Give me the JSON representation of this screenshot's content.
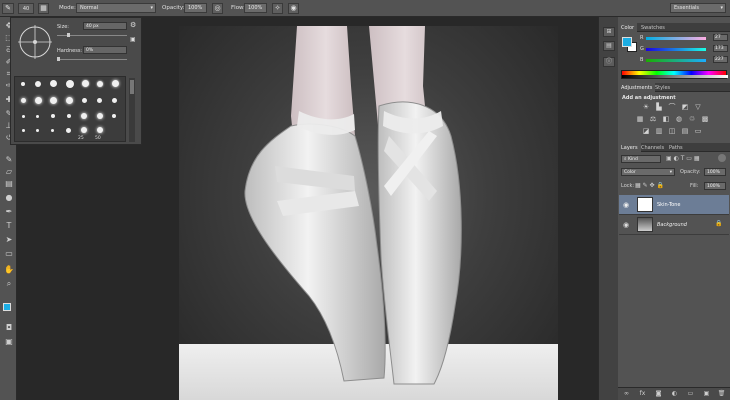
{
  "options_bar": {
    "brush_size": "40",
    "mode_label": "Mode:",
    "mode_value": "Normal",
    "opacity_label": "Opacity:",
    "opacity_value": "100%",
    "flow_label": "Flow:",
    "flow_value": "100%",
    "workspace": "Essentials"
  },
  "brush_panel": {
    "size_label": "Size:",
    "size_value": "40 px",
    "hardness_label": "Hardness:",
    "hardness_value": "0%",
    "preset_sizes": [
      "25",
      "50"
    ]
  },
  "color_panel": {
    "tabs": [
      "Color",
      "Swatches"
    ],
    "sliders": [
      {
        "label": "R",
        "value": "27"
      },
      {
        "label": "G",
        "value": "173"
      },
      {
        "label": "B",
        "value": "227"
      }
    ],
    "foreground": "#1badE3",
    "accent": "#1bade3"
  },
  "adjustments_panel": {
    "tabs": [
      "Adjustments",
      "Styles"
    ],
    "heading": "Add an adjustment"
  },
  "layers_panel": {
    "tabs": [
      "Layers",
      "Channels",
      "Paths"
    ],
    "filter_kind": "Kind",
    "blend_mode": "Color",
    "opacity_label": "Opacity:",
    "opacity_value": "100%",
    "lock_label": "Lock:",
    "fill_label": "Fill:",
    "fill_value": "100%",
    "layers": [
      {
        "name": "Skin-Tone",
        "selected": true
      },
      {
        "name": "Background",
        "selected": false
      }
    ]
  }
}
